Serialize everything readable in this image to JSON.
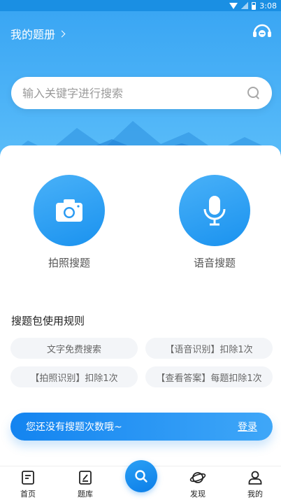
{
  "status_bar": {
    "time": "3:08"
  },
  "header": {
    "my_book_label": "我的题册",
    "service_icon": "customer-service-headset-icon"
  },
  "search": {
    "placeholder": "输入关键字进行搜索",
    "icon": "search-icon"
  },
  "actions": [
    {
      "label": "拍照搜题",
      "icon": "camera-icon"
    },
    {
      "label": "语音搜题",
      "icon": "microphone-icon"
    }
  ],
  "rules": {
    "title": "搜题包使用规则",
    "items": [
      "文字免费搜索",
      "【语音识别】扣除1次",
      "【拍照识别】扣除1次",
      "【查看答案】每题扣除1次"
    ]
  },
  "login_bar": {
    "message": "您还没有搜题次数哦~",
    "login_label": "登录"
  },
  "tabbar": {
    "items": [
      {
        "label": "首页",
        "icon": "home-doc-icon"
      },
      {
        "label": "题库",
        "icon": "question-bank-icon"
      },
      {
        "label": "",
        "icon": "search-icon"
      },
      {
        "label": "发现",
        "icon": "planet-icon"
      },
      {
        "label": "我的",
        "icon": "user-icon"
      }
    ]
  },
  "colors": {
    "primary": "#1a92ef",
    "hero_top": "#3aa6f3",
    "chip_bg": "#f3f5f8"
  }
}
